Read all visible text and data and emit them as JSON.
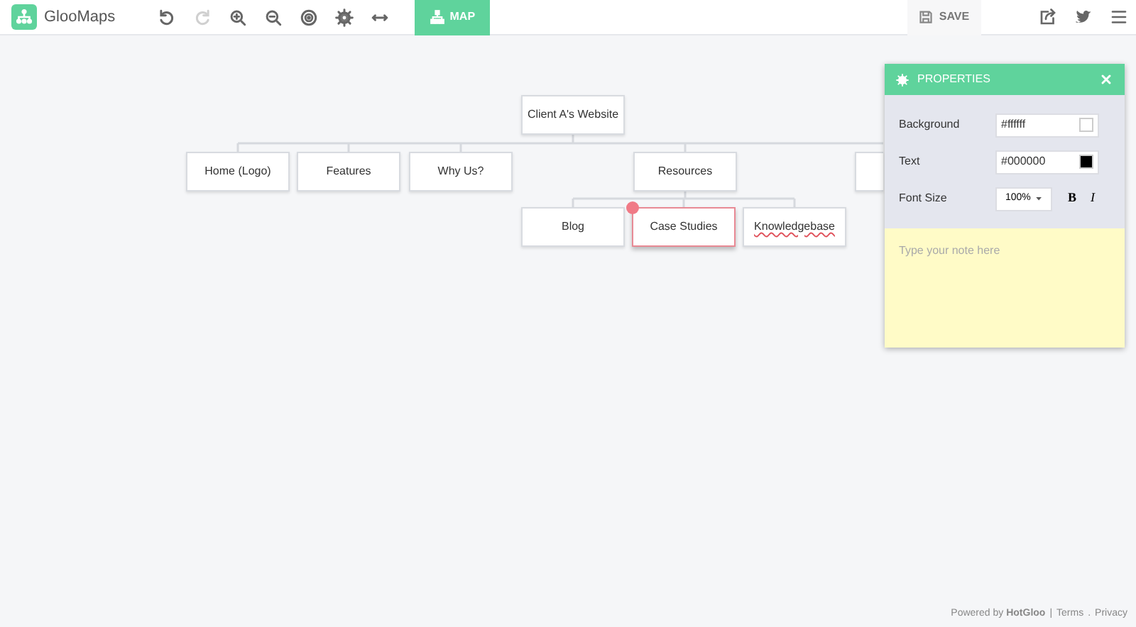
{
  "app": {
    "name": "GlooMaps"
  },
  "toolbar": [
    {
      "kind": "undo",
      "disabled": false
    },
    {
      "kind": "redo",
      "disabled": true
    },
    {
      "kind": "zoom-in",
      "disabled": false
    },
    {
      "kind": "zoom-out",
      "disabled": false
    },
    {
      "kind": "target",
      "disabled": false
    },
    {
      "kind": "settings",
      "disabled": false
    },
    {
      "kind": "width",
      "disabled": false
    }
  ],
  "tabs": [
    {
      "label": "MAP",
      "selected": true
    }
  ],
  "save": {
    "label": "SAVE"
  },
  "map": {
    "root": {
      "label": "Client A's Website",
      "selected": false,
      "children": [
        {
          "label": "Home (Logo)",
          "selected": false
        },
        {
          "label": "Features",
          "selected": false
        },
        {
          "label": "Why Us?",
          "selected": false
        },
        {
          "label": "Resources",
          "selected": false,
          "children": [
            {
              "label": "Blog",
              "selected": false
            },
            {
              "label": "Case Studies",
              "selected": true
            },
            {
              "label": "Knowledgebase",
              "selected": false,
              "misspelled": true
            }
          ]
        },
        {
          "selected": false
        }
      ]
    }
  },
  "properties": {
    "title": "PROPERTIES",
    "background_label": "Background",
    "background": "#ffffff",
    "text_label": "Text",
    "text": "#000000",
    "font_size_label": "Font Size",
    "font_size": "100%",
    "bold": "B",
    "italic": "I",
    "note_placeholder": "Type your note here"
  },
  "footer": {
    "powered": "Powered by **HotGloo**",
    "sep": "|",
    "terms": "Terms",
    "dot": ".",
    "privacy": "Privacy"
  }
}
